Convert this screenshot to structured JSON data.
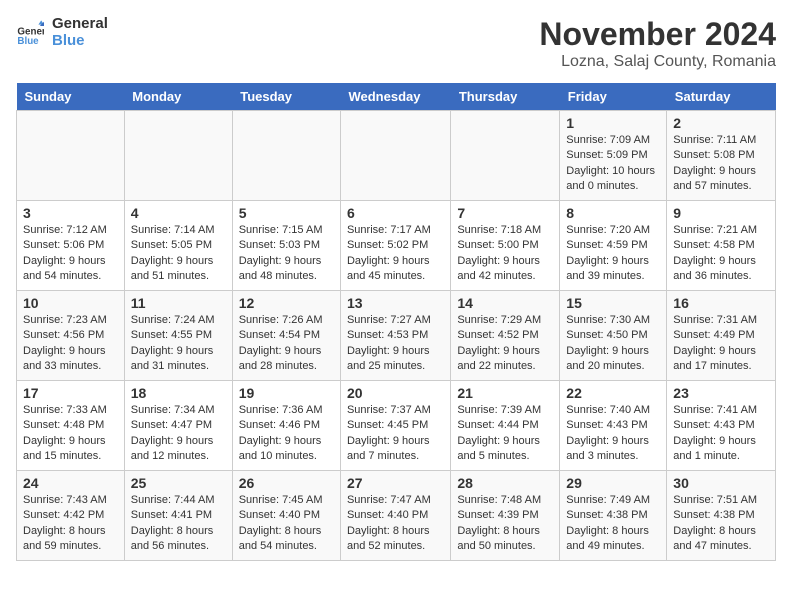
{
  "logo": {
    "line1": "General",
    "line2": "Blue"
  },
  "title": "November 2024",
  "location": "Lozna, Salaj County, Romania",
  "headers": [
    "Sunday",
    "Monday",
    "Tuesday",
    "Wednesday",
    "Thursday",
    "Friday",
    "Saturday"
  ],
  "weeks": [
    [
      {
        "day": "",
        "info": ""
      },
      {
        "day": "",
        "info": ""
      },
      {
        "day": "",
        "info": ""
      },
      {
        "day": "",
        "info": ""
      },
      {
        "day": "",
        "info": ""
      },
      {
        "day": "1",
        "info": "Sunrise: 7:09 AM\nSunset: 5:09 PM\nDaylight: 10 hours\nand 0 minutes."
      },
      {
        "day": "2",
        "info": "Sunrise: 7:11 AM\nSunset: 5:08 PM\nDaylight: 9 hours\nand 57 minutes."
      }
    ],
    [
      {
        "day": "3",
        "info": "Sunrise: 7:12 AM\nSunset: 5:06 PM\nDaylight: 9 hours\nand 54 minutes."
      },
      {
        "day": "4",
        "info": "Sunrise: 7:14 AM\nSunset: 5:05 PM\nDaylight: 9 hours\nand 51 minutes."
      },
      {
        "day": "5",
        "info": "Sunrise: 7:15 AM\nSunset: 5:03 PM\nDaylight: 9 hours\nand 48 minutes."
      },
      {
        "day": "6",
        "info": "Sunrise: 7:17 AM\nSunset: 5:02 PM\nDaylight: 9 hours\nand 45 minutes."
      },
      {
        "day": "7",
        "info": "Sunrise: 7:18 AM\nSunset: 5:00 PM\nDaylight: 9 hours\nand 42 minutes."
      },
      {
        "day": "8",
        "info": "Sunrise: 7:20 AM\nSunset: 4:59 PM\nDaylight: 9 hours\nand 39 minutes."
      },
      {
        "day": "9",
        "info": "Sunrise: 7:21 AM\nSunset: 4:58 PM\nDaylight: 9 hours\nand 36 minutes."
      }
    ],
    [
      {
        "day": "10",
        "info": "Sunrise: 7:23 AM\nSunset: 4:56 PM\nDaylight: 9 hours\nand 33 minutes."
      },
      {
        "day": "11",
        "info": "Sunrise: 7:24 AM\nSunset: 4:55 PM\nDaylight: 9 hours\nand 31 minutes."
      },
      {
        "day": "12",
        "info": "Sunrise: 7:26 AM\nSunset: 4:54 PM\nDaylight: 9 hours\nand 28 minutes."
      },
      {
        "day": "13",
        "info": "Sunrise: 7:27 AM\nSunset: 4:53 PM\nDaylight: 9 hours\nand 25 minutes."
      },
      {
        "day": "14",
        "info": "Sunrise: 7:29 AM\nSunset: 4:52 PM\nDaylight: 9 hours\nand 22 minutes."
      },
      {
        "day": "15",
        "info": "Sunrise: 7:30 AM\nSunset: 4:50 PM\nDaylight: 9 hours\nand 20 minutes."
      },
      {
        "day": "16",
        "info": "Sunrise: 7:31 AM\nSunset: 4:49 PM\nDaylight: 9 hours\nand 17 minutes."
      }
    ],
    [
      {
        "day": "17",
        "info": "Sunrise: 7:33 AM\nSunset: 4:48 PM\nDaylight: 9 hours\nand 15 minutes."
      },
      {
        "day": "18",
        "info": "Sunrise: 7:34 AM\nSunset: 4:47 PM\nDaylight: 9 hours\nand 12 minutes."
      },
      {
        "day": "19",
        "info": "Sunrise: 7:36 AM\nSunset: 4:46 PM\nDaylight: 9 hours\nand 10 minutes."
      },
      {
        "day": "20",
        "info": "Sunrise: 7:37 AM\nSunset: 4:45 PM\nDaylight: 9 hours\nand 7 minutes."
      },
      {
        "day": "21",
        "info": "Sunrise: 7:39 AM\nSunset: 4:44 PM\nDaylight: 9 hours\nand 5 minutes."
      },
      {
        "day": "22",
        "info": "Sunrise: 7:40 AM\nSunset: 4:43 PM\nDaylight: 9 hours\nand 3 minutes."
      },
      {
        "day": "23",
        "info": "Sunrise: 7:41 AM\nSunset: 4:43 PM\nDaylight: 9 hours\nand 1 minute."
      }
    ],
    [
      {
        "day": "24",
        "info": "Sunrise: 7:43 AM\nSunset: 4:42 PM\nDaylight: 8 hours\nand 59 minutes."
      },
      {
        "day": "25",
        "info": "Sunrise: 7:44 AM\nSunset: 4:41 PM\nDaylight: 8 hours\nand 56 minutes."
      },
      {
        "day": "26",
        "info": "Sunrise: 7:45 AM\nSunset: 4:40 PM\nDaylight: 8 hours\nand 54 minutes."
      },
      {
        "day": "27",
        "info": "Sunrise: 7:47 AM\nSunset: 4:40 PM\nDaylight: 8 hours\nand 52 minutes."
      },
      {
        "day": "28",
        "info": "Sunrise: 7:48 AM\nSunset: 4:39 PM\nDaylight: 8 hours\nand 50 minutes."
      },
      {
        "day": "29",
        "info": "Sunrise: 7:49 AM\nSunset: 4:38 PM\nDaylight: 8 hours\nand 49 minutes."
      },
      {
        "day": "30",
        "info": "Sunrise: 7:51 AM\nSunset: 4:38 PM\nDaylight: 8 hours\nand 47 minutes."
      }
    ]
  ]
}
